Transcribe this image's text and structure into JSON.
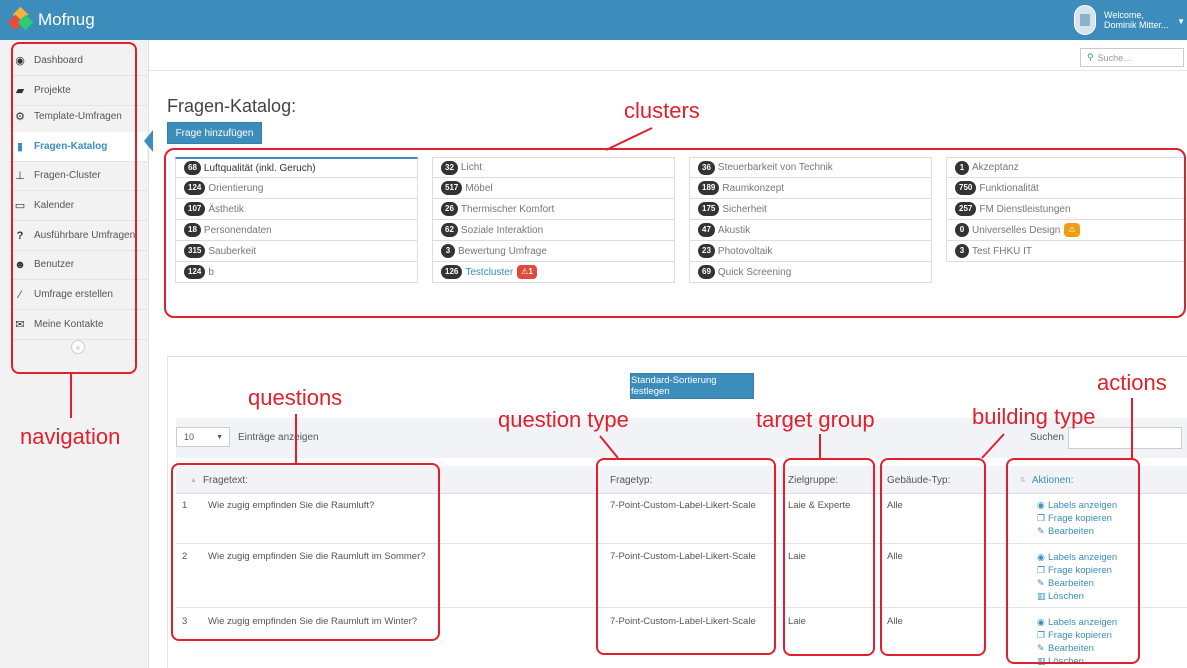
{
  "app": {
    "name": "Mofnug"
  },
  "user": {
    "welcome": "Welcome,",
    "name": "Dominik Mitter..."
  },
  "search_top": {
    "placeholder": "Suche..."
  },
  "sidebar": {
    "items": [
      {
        "label": "Dashboard",
        "icon": "dashboard-icon"
      },
      {
        "label": "Projekte",
        "icon": "folder-icon"
      },
      {
        "label": "Template-Umfragen",
        "icon": "gears-icon"
      },
      {
        "label": "Fragen-Katalog",
        "icon": "book-icon",
        "active": true
      },
      {
        "label": "Fragen-Cluster",
        "icon": "sitemap-icon"
      },
      {
        "label": "Kalender",
        "icon": "calendar-icon"
      },
      {
        "label": "Ausführbare Umfragen",
        "icon": "question-icon"
      },
      {
        "label": "Benutzer",
        "icon": "users-icon"
      },
      {
        "label": "Umfrage erstellen",
        "icon": "magic-icon"
      },
      {
        "label": "Meine Kontakte",
        "icon": "envelope-icon"
      }
    ]
  },
  "page": {
    "title": "Fragen-Katalog:",
    "add_button": "Frage hinzufügen"
  },
  "clusters": {
    "col1": [
      {
        "count": "68",
        "name": "Luftqualität (inkl. Geruch)"
      },
      {
        "count": "124",
        "name": "Orientierung"
      },
      {
        "count": "107",
        "name": "Ästhetik"
      },
      {
        "count": "18",
        "name": "Personendaten"
      },
      {
        "count": "315",
        "name": "Sauberkeit"
      },
      {
        "count": "124",
        "name": "b"
      }
    ],
    "col2": [
      {
        "count": "32",
        "name": "Licht"
      },
      {
        "count": "517",
        "name": "Möbel"
      },
      {
        "count": "26",
        "name": "Thermischer Komfort"
      },
      {
        "count": "62",
        "name": "Soziale Interaktion"
      },
      {
        "count": "3",
        "name": "Bewertung Umfrage"
      },
      {
        "count": "126",
        "name": "Testcluster",
        "warn": "⚠1"
      }
    ],
    "col3": [
      {
        "count": "36",
        "name": "Steuerbarkeit von Technik"
      },
      {
        "count": "189",
        "name": "Raumkonzept"
      },
      {
        "count": "175",
        "name": "Sicherheit"
      },
      {
        "count": "47",
        "name": "Akustik"
      },
      {
        "count": "23",
        "name": "Photovoltaik"
      },
      {
        "count": "69",
        "name": "Quick Screening"
      }
    ],
    "col4": [
      {
        "count": "1",
        "name": "Akzeptanz"
      },
      {
        "count": "750",
        "name": "Funktionalität"
      },
      {
        "count": "257",
        "name": "FM Dienstleistungen"
      },
      {
        "count": "0",
        "name": "Universelles Design",
        "warn": "⚠"
      },
      {
        "count": "3",
        "name": "Test FHKU IT"
      }
    ]
  },
  "table": {
    "sort_button": "Standard-Sortierung festlegen",
    "length_value": "10",
    "length_label": "Einträge anzeigen",
    "search_label": "Suchen",
    "headers": {
      "text": "Fragetext:",
      "type": "Fragetyp:",
      "target": "Zielgruppe:",
      "building": "Gebäude-Typ:",
      "actions": "Aktionen:"
    },
    "rows": [
      {
        "n": "1",
        "text": "Wie zugig empfinden Sie die Raumluft?",
        "type": "7-Point-Custom-Label-Likert-Scale",
        "target": "Laie & Experte",
        "building": "Alle",
        "actions": [
          "Labels anzeigen",
          "Frage kopieren",
          "Bearbeiten"
        ]
      },
      {
        "n": "2",
        "text": "Wie zugig empfinden Sie die Raumluft im Sommer?",
        "type": "7-Point-Custom-Label-Likert-Scale",
        "target": "Laie",
        "building": "Alle",
        "actions": [
          "Labels anzeigen",
          "Frage kopieren",
          "Bearbeiten",
          "Löschen"
        ]
      },
      {
        "n": "3",
        "text": "Wie zugig empfinden Sie die Raumluft im Winter?",
        "type": "7-Point-Custom-Label-Likert-Scale",
        "target": "Laie",
        "building": "Alle",
        "actions": [
          "Labels anzeigen",
          "Frage kopieren",
          "Bearbeiten",
          "Löschen"
        ]
      }
    ]
  },
  "annotations": {
    "clusters": "clusters",
    "navigation": "navigation",
    "questions": "questions",
    "question_type": "question type",
    "target_group": "target group",
    "building_type": "building type",
    "actions": "actions",
    "color": "#e0202c"
  }
}
